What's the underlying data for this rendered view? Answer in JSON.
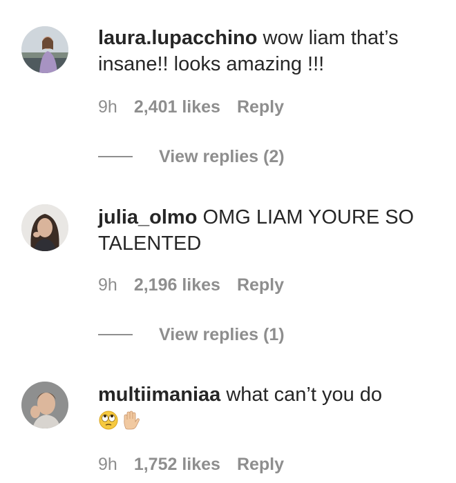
{
  "comments": [
    {
      "username": "laura.lupacchino",
      "text": "wow liam that’s insane!! looks amazing !!!",
      "time": "9h",
      "likes": "2,401 likes",
      "reply": "Reply",
      "view_replies": "View replies (2)"
    },
    {
      "username": "julia_olmo",
      "text": "OMG LIAM YOURE SO TALENTED",
      "time": "9h",
      "likes": "2,196 likes",
      "reply": "Reply",
      "view_replies": "View replies (1)"
    },
    {
      "username": "multiimaniaa",
      "text": "what can’t you do",
      "emoji": [
        "face-with-rolling-eyes",
        "raised-hand"
      ],
      "time": "9h",
      "likes": "1,752 likes",
      "reply": "Reply"
    }
  ]
}
